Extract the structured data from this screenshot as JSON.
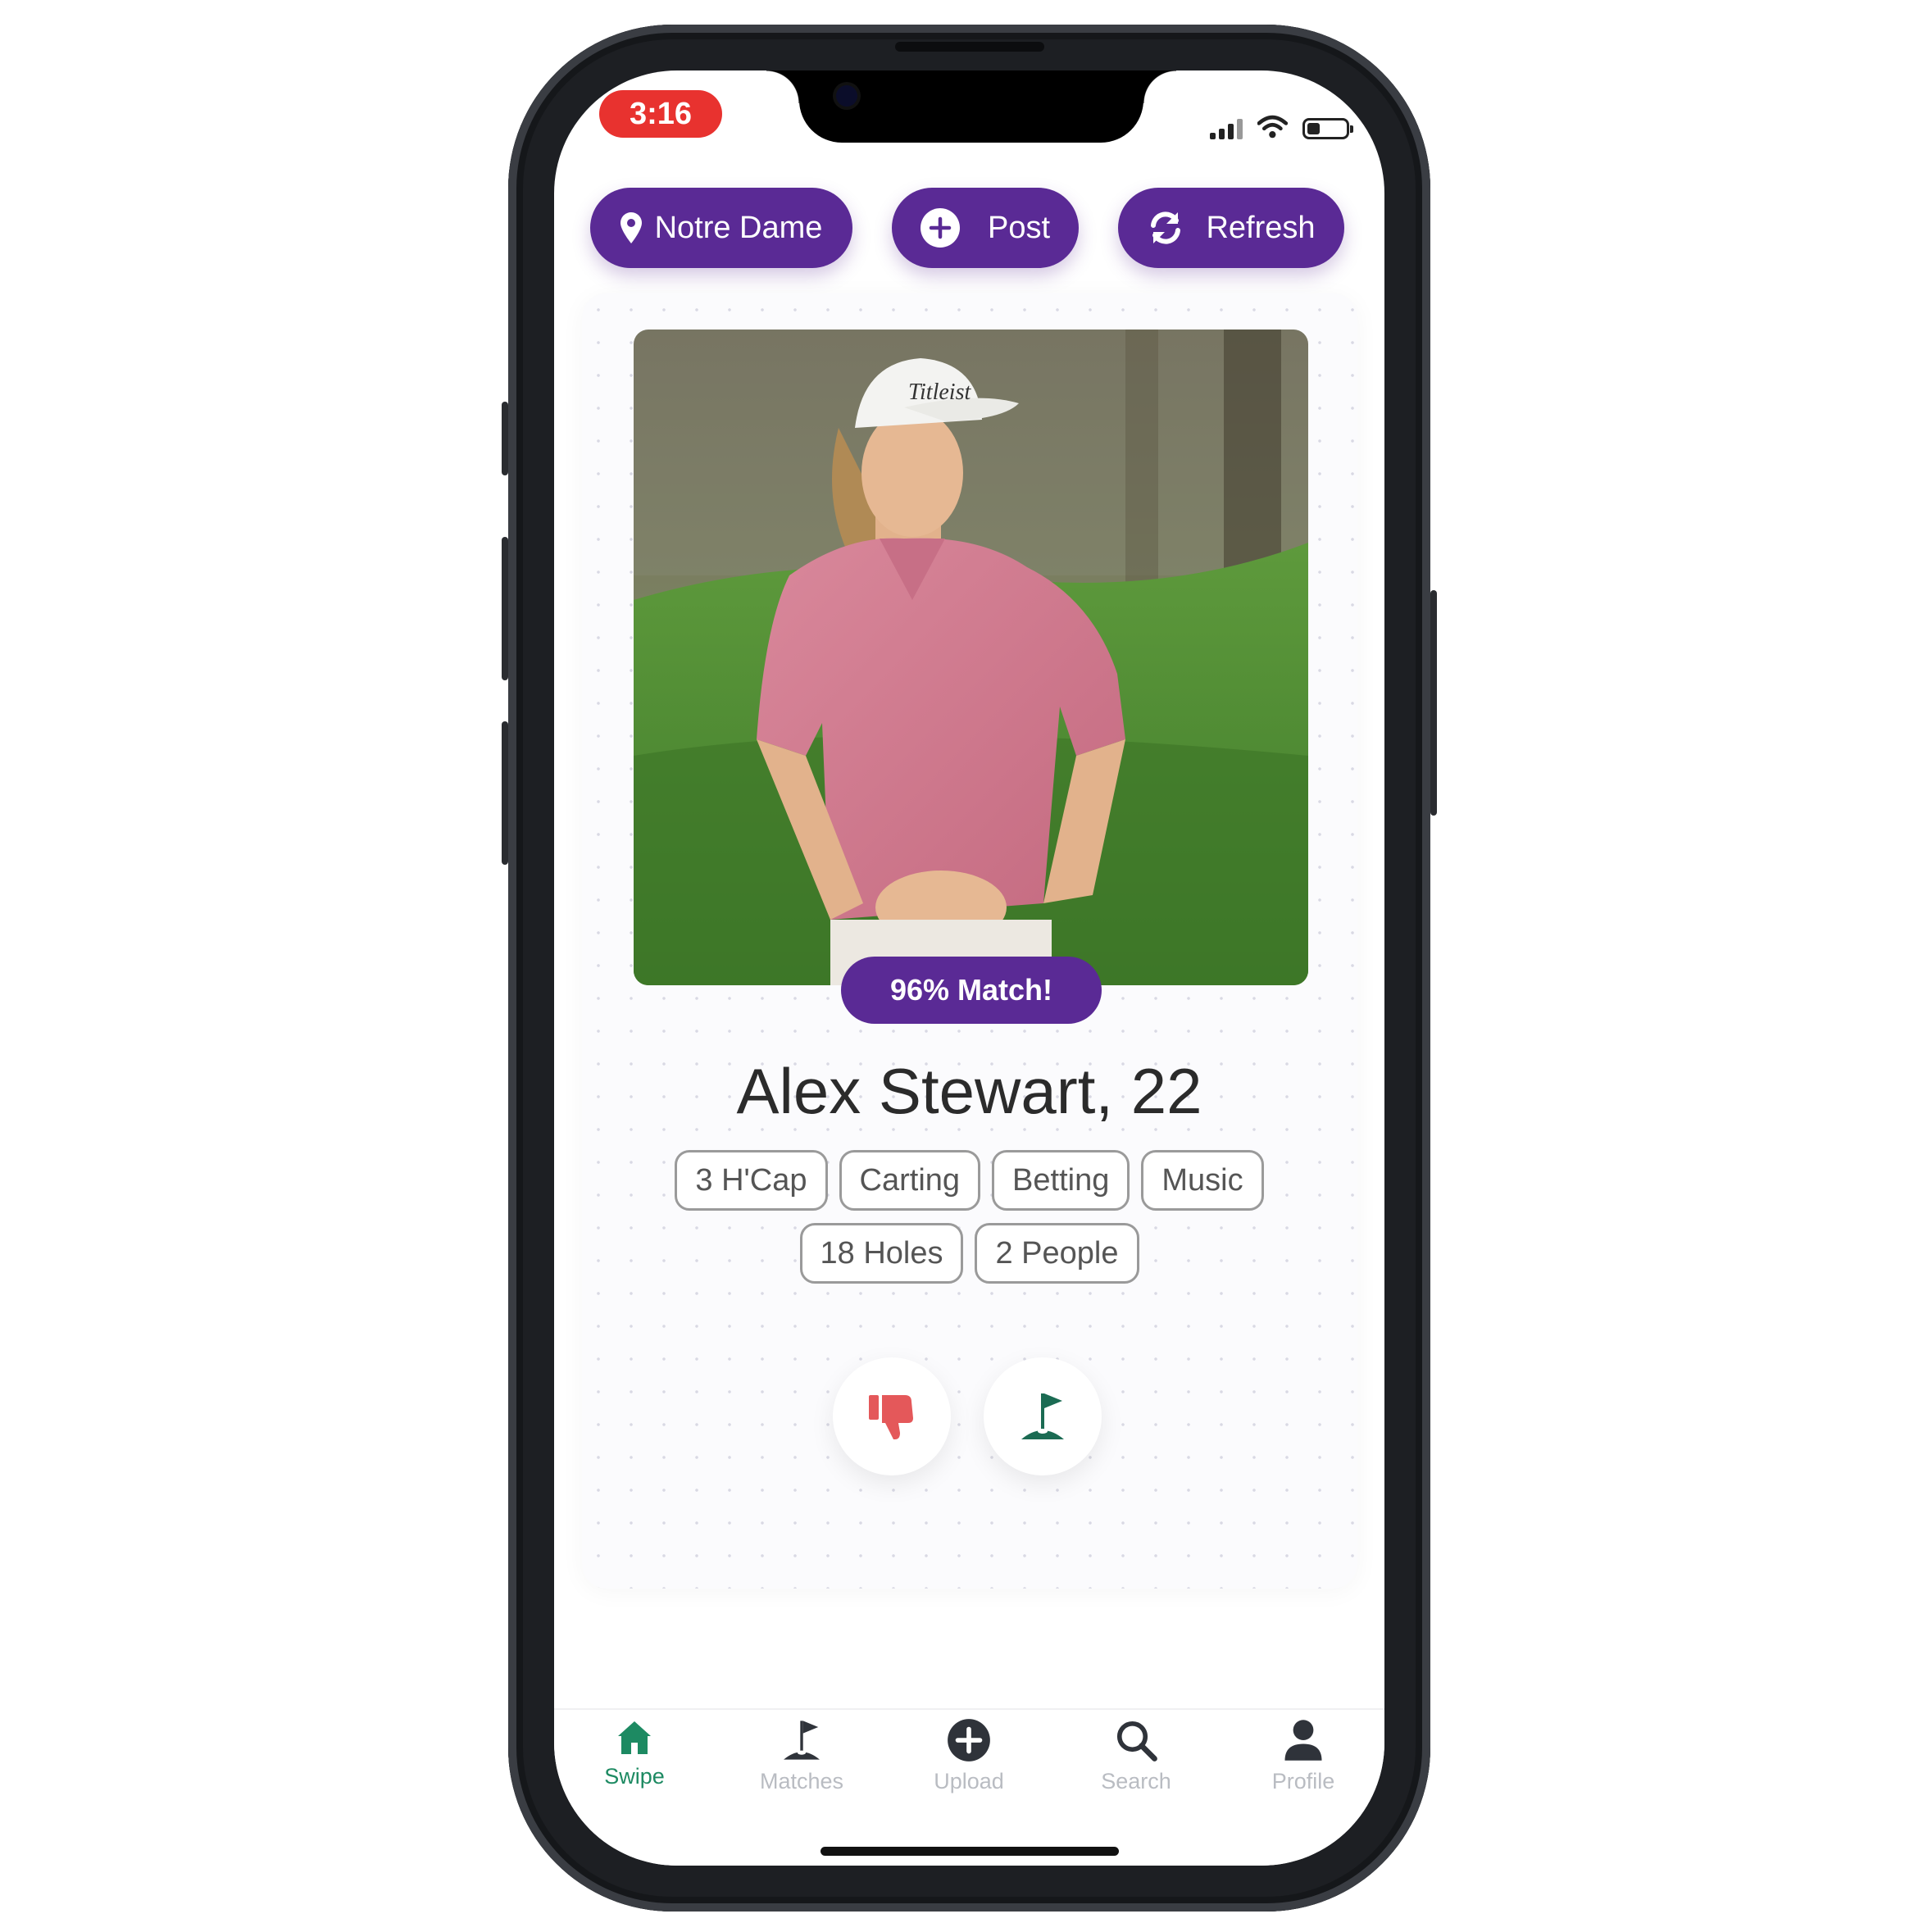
{
  "status_bar": {
    "time": "3:16",
    "battery_level": 0.3
  },
  "top_actions": {
    "location_label": "Notre Dame",
    "post_label": "Post",
    "refresh_label": "Refresh"
  },
  "profile": {
    "match_badge": "96% Match!",
    "name_age": "Alex Stewart, 22",
    "tags_row1": [
      "3 H'Cap",
      "Carting",
      "Betting",
      "Music"
    ],
    "tags_row2": [
      "18 Holes",
      "2 People"
    ]
  },
  "actions": {
    "dislike_icon": "thumbs-down-icon",
    "like_icon": "golf-flag-icon"
  },
  "nav": {
    "items": [
      {
        "label": "Swipe",
        "icon": "home-icon",
        "active": true
      },
      {
        "label": "Matches",
        "icon": "golf-flag-icon",
        "active": false
      },
      {
        "label": "Upload",
        "icon": "plus-circle-icon",
        "active": false
      },
      {
        "label": "Search",
        "icon": "search-icon",
        "active": false
      },
      {
        "label": "Profile",
        "icon": "user-icon",
        "active": false
      }
    ]
  },
  "colors": {
    "accent": "#5a2a95",
    "time_pill": "#e8322f",
    "active_nav": "#1d8a62",
    "dislike": "#e4585a",
    "like": "#1b6b53"
  }
}
